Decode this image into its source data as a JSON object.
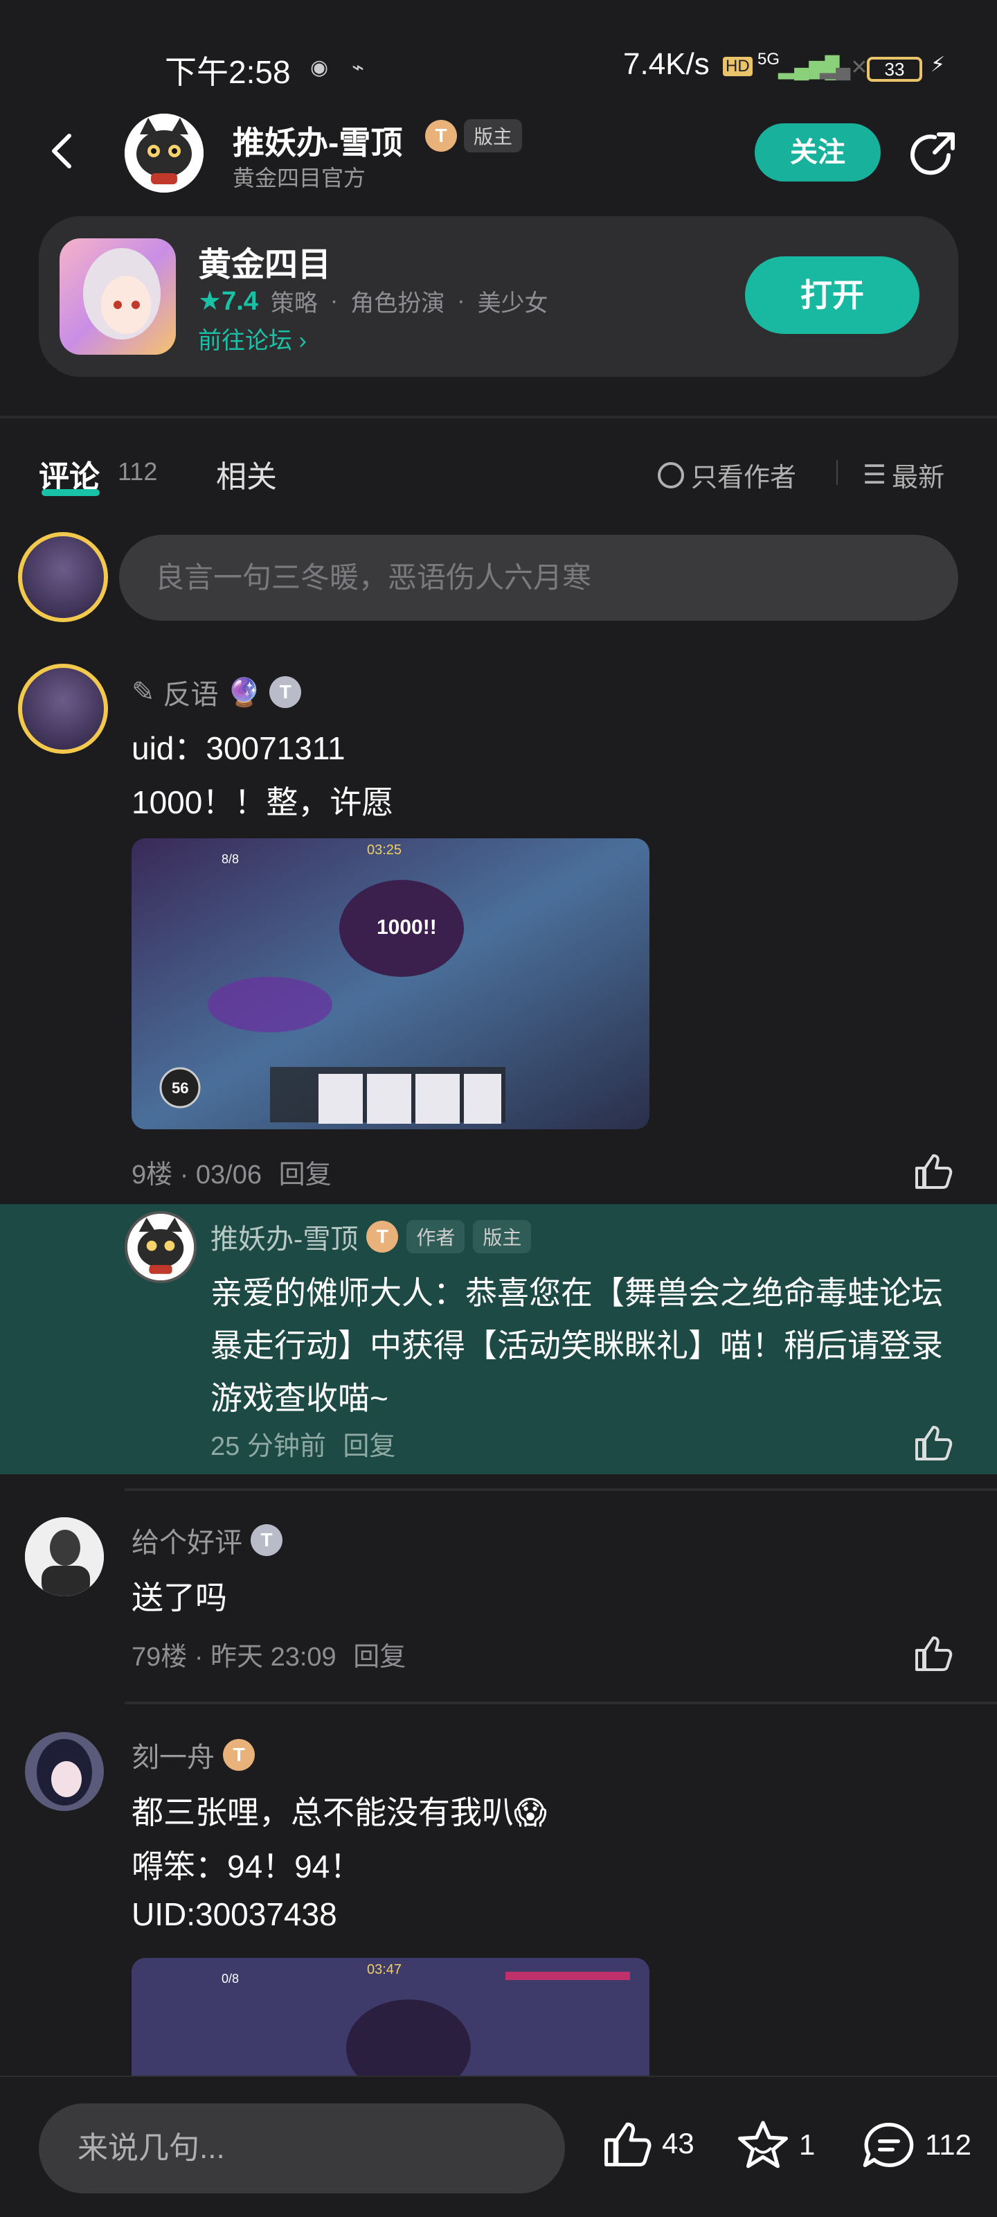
{
  "status": {
    "time": "下午2:58",
    "speed": "7.4K/s",
    "hd": "HD",
    "net": "5G",
    "battery": "33"
  },
  "header": {
    "author_name": "推妖办-雪顶",
    "author_sub": "黄金四目官方",
    "badge_letter": "T",
    "moderator_tag": "版主",
    "follow_label": "关注"
  },
  "game": {
    "title": "黄金四目",
    "rating": "7.4",
    "tags": [
      "策略",
      "角色扮演",
      "美少女"
    ],
    "forum_link": "前往论坛",
    "open_label": "打开"
  },
  "tabs": {
    "comments_label": "评论",
    "comments_count": "112",
    "related_label": "相关",
    "only_author_label": "只看作者",
    "sort_label": "最新"
  },
  "comment_input": {
    "placeholder": "良言一句三冬暖，恶语伤人六月寒"
  },
  "posts": [
    {
      "name": "反语",
      "badge": "T",
      "lines": [
        "uid：30071311",
        "1000！！整，许愿"
      ],
      "meta": "9楼 · 03/06",
      "reply_label": "回复",
      "screenshot": {
        "timer": "03:25",
        "damage": "1000!!",
        "count": "8/8",
        "level": "56"
      },
      "reply": {
        "name": "推妖办-雪顶",
        "badge": "T",
        "author_tag": "作者",
        "moderator_tag": "版主",
        "text": "亲爱的傩师大人：恭喜您在【舞兽会之绝命毒蛙论坛暴走行动】中获得【活动笑眯眯礼】喵！稍后请登录游戏查收喵~",
        "meta": "25 分钟前",
        "reply_label": "回复"
      }
    },
    {
      "name": "给个好评",
      "badge": "T",
      "lines": [
        "送了吗"
      ],
      "meta": "79楼 · 昨天 23:09",
      "reply_label": "回复"
    },
    {
      "name": "刻一舟",
      "badge": "T",
      "lines": [
        "都三张哩，总不能没有我叭😱",
        "嘚笨：94！94！",
        "UID:30037438"
      ],
      "screenshot": {
        "timer": "03:47",
        "count": "0/8"
      }
    }
  ],
  "bottom": {
    "input_placeholder": "来说几句...",
    "likes": "43",
    "favorites": "1",
    "comments": "112"
  },
  "colors": {
    "accent": "#19b8a0",
    "background": "#1c1c1e",
    "reply_bg": "#1d4a44"
  }
}
